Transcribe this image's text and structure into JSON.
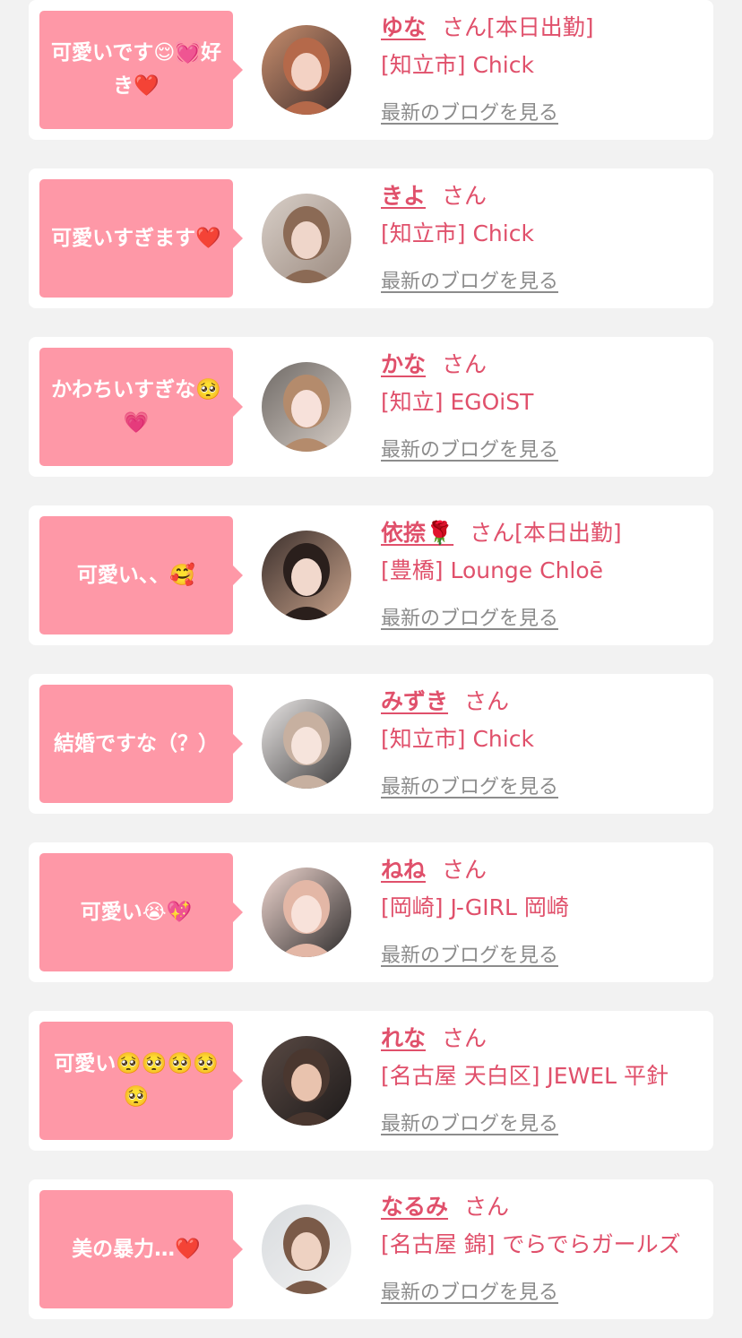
{
  "colors": {
    "page_bg": "#f2f2f2",
    "card_bg": "#ffffff",
    "bubble_bg": "#fe98a7",
    "accent_text": "#e0506b",
    "link_gray": "#8c8c8c"
  },
  "entries": [
    {
      "comment": "可愛いです😌💓好き❤️",
      "name": "ゆな",
      "name_suffix": "さん[本日出勤]",
      "shop": "[知立市] Chick",
      "blog_link": "最新のブログを見る",
      "avatar": {
        "c1": "#c98f6e",
        "c2": "#3a2a2a",
        "hair": "#b5694a",
        "skin": "#f3d2c4"
      }
    },
    {
      "comment": "可愛いすぎます❤️",
      "name": "きよ",
      "name_suffix": "さん",
      "shop": "[知立市] Chick",
      "blog_link": "最新のブログを見る",
      "avatar": {
        "c1": "#d8cfc8",
        "c2": "#9b8a7f",
        "hair": "#8b6a55",
        "skin": "#efd6ca"
      }
    },
    {
      "comment": "かわちいすぎな🥺💗",
      "name": "かな",
      "name_suffix": "さん",
      "shop": "[知立] EGOiST",
      "blog_link": "最新のブログを見る",
      "avatar": {
        "c1": "#6f6a66",
        "c2": "#d8cfc8",
        "hair": "#b48b6c",
        "skin": "#f7e1da"
      }
    },
    {
      "comment": "可愛い、、🥰",
      "name": "依捺🌹",
      "name_suffix": "さん[本日出勤]",
      "shop": "[豊橋] Lounge Chloē",
      "blog_link": "最新のブログを見る",
      "avatar": {
        "c1": "#3b2f2c",
        "c2": "#caa48c",
        "hair": "#2a1f1c",
        "skin": "#f1d8cc"
      }
    },
    {
      "comment": "結婚ですな（？）",
      "name": "みずき",
      "name_suffix": "さん",
      "shop": "[知立市] Chick",
      "blog_link": "最新のブログを見る",
      "avatar": {
        "c1": "#e9e6e5",
        "c2": "#3a3838",
        "hair": "#c7b0a0",
        "skin": "#f6e4dc"
      }
    },
    {
      "comment": "可愛い😭💖",
      "name": "ねね",
      "name_suffix": "さん",
      "shop": "[岡崎] J-GIRL 岡崎",
      "blog_link": "最新のブログを見る",
      "avatar": {
        "c1": "#f0d7d0",
        "c2": "#2d2b2b",
        "hair": "#e3b7a6",
        "skin": "#f8e2da"
      }
    },
    {
      "comment": "可愛い🥺🥺🥺🥺🥺",
      "name": "れな",
      "name_suffix": "さん",
      "shop": "[名古屋 天白区] JEWEL 平針",
      "blog_link": "最新のブログを見る",
      "avatar": {
        "c1": "#5a4a44",
        "c2": "#1d1a1a",
        "hair": "#4a372f",
        "skin": "#e9c3ae"
      }
    },
    {
      "comment": "美の暴力…❤️",
      "name": "なるみ",
      "name_suffix": "さん",
      "shop": "[名古屋 錦] でらでらガールズ",
      "blog_link": "最新のブログを見る",
      "avatar": {
        "c1": "#d9dcdf",
        "c2": "#f2f2f2",
        "hair": "#7a5a48",
        "skin": "#eed2c2"
      }
    }
  ]
}
